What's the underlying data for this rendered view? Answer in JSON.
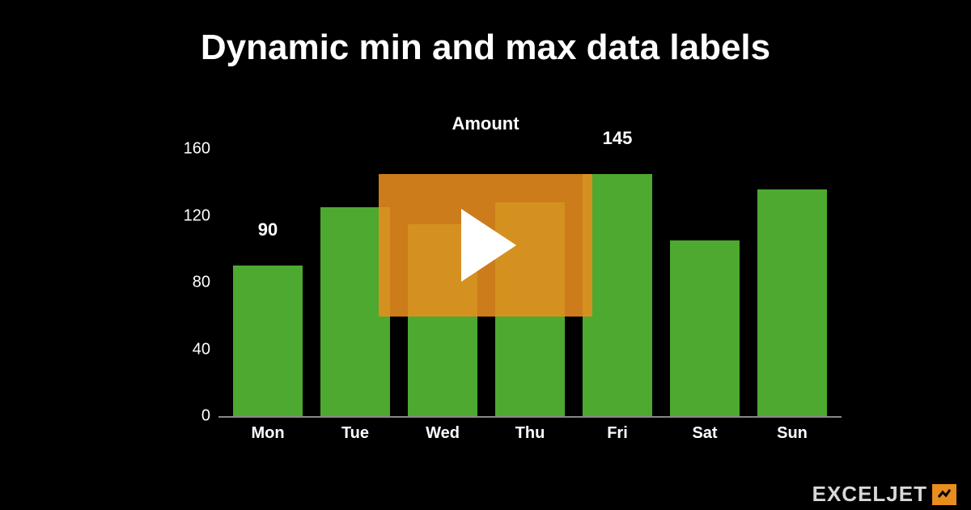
{
  "title": "Dynamic min and max data labels",
  "chart_data": {
    "type": "bar",
    "title": "Amount",
    "xlabel": "",
    "ylabel": "",
    "ylim": [
      0,
      160
    ],
    "yticks": [
      0,
      40,
      80,
      120,
      160
    ],
    "categories": [
      "Mon",
      "Tue",
      "Wed",
      "Thu",
      "Fri",
      "Sat",
      "Sun"
    ],
    "values": [
      90,
      125,
      115,
      128,
      145,
      105,
      136
    ],
    "data_labels": [
      "90",
      "",
      "",
      "",
      "145",
      "",
      ""
    ],
    "bar_color": "#4da92f"
  },
  "brand": {
    "text": "EXCELJET"
  }
}
